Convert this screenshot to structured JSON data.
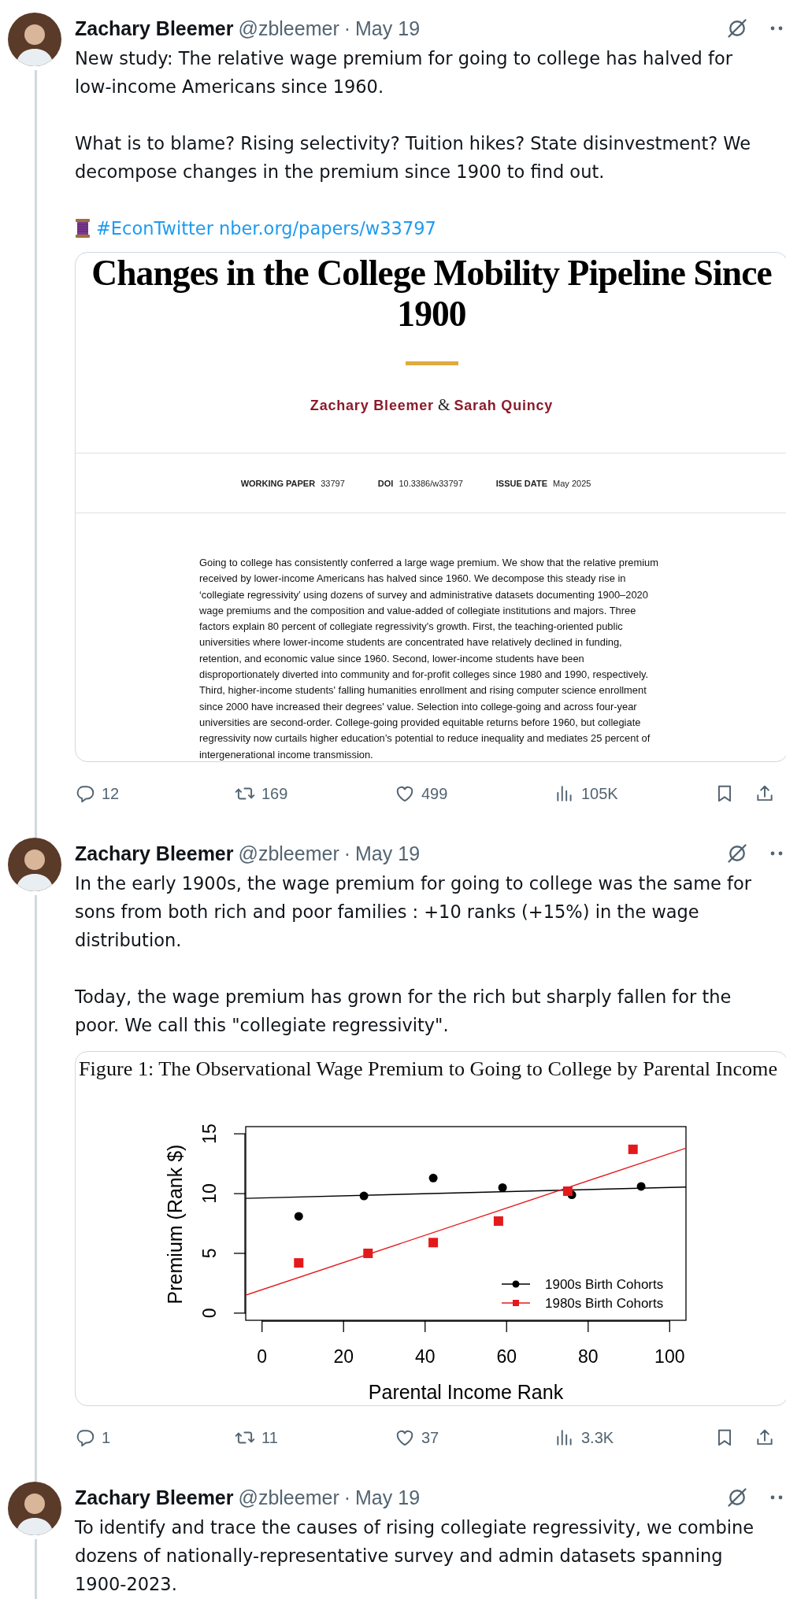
{
  "thread": [
    {
      "author": {
        "name": "Zachary Bleemer",
        "handle": "@zbleemer",
        "separator": "·",
        "date": "May 19"
      },
      "paragraphs": [
        {
          "kind": "text",
          "text": "New study: The relative wage premium for going to college has halved for low-income Americans since 1960."
        },
        {
          "kind": "text",
          "text": "What is to blame? Rising selectivity? Tuition hikes? State disinvestment? We decompose changes in the premium since 1900 to find out."
        },
        {
          "kind": "links",
          "links": [
            {
              "text": "#EconTwitter"
            },
            {
              "text": "nber.org/papers/w33797"
            }
          ]
        }
      ],
      "card": {
        "kind": "paper",
        "title": "Changes in the College Mobility Pipeline Since 1900",
        "authors": [
          {
            "name": "Zachary Bleemer"
          },
          {
            "name": "Sarah Quincy"
          }
        ],
        "conjunction": "&",
        "meta": [
          {
            "label": "WORKING PAPER",
            "value": "33797"
          },
          {
            "label": "DOI",
            "value": "10.3386/w33797"
          },
          {
            "label": "ISSUE DATE",
            "value": "May 2025"
          }
        ],
        "abstract": "Going to college has consistently conferred a large wage premium. We show that the relative premium received by lower-income Americans has halved since 1960. We decompose this steady rise in ‘collegiate regressivity’ using dozens of survey and administrative datasets documenting 1900–2020 wage premiums and the composition and value-added of collegiate institutions and majors. Three factors explain 80 percent of collegiate regressivity's growth. First, the teaching-oriented public universities where lower-income students are concentrated have relatively declined in funding, retention, and economic value since 1960. Second, lower-income students have been disproportionately diverted into community and for-profit colleges since 1980 and 1990, respectively. Third, higher-income students' falling humanities enrollment and rising computer science enrollment since 2000 have increased their degrees' value. Selection into college-going and across four-year universities are second-order. College-going provided equitable returns before 1960, but collegiate regressivity now curtails higher education’s potential to reduce inequality and mediates 25 percent of intergenerational income transmission."
      },
      "actions": [
        {
          "kind": "reply",
          "count": "12"
        },
        {
          "kind": "repost",
          "count": "169"
        },
        {
          "kind": "like",
          "count": "499"
        },
        {
          "kind": "views",
          "count": "105K"
        },
        {
          "kind": "bookmark"
        },
        {
          "kind": "share"
        }
      ]
    },
    {
      "author": {
        "name": "Zachary Bleemer",
        "handle": "@zbleemer",
        "separator": "·",
        "date": "May 19"
      },
      "paragraphs": [
        {
          "kind": "text",
          "text": "In the early 1900s, the wage premium for going to college was the same for sons from both rich and poor families : +10 ranks (+15%) in the wage distribution."
        },
        {
          "kind": "text",
          "text": "Today, the wage premium has grown for the rich but sharply fallen for the poor. We call this \"collegiate regressivity\"."
        }
      ],
      "card": {
        "kind": "figure",
        "chart_data": {
          "type": "scatter",
          "title": "Figure 1: The Observational Wage Premium to Going to College by Parental Income",
          "xlabel": "Parental Income Rank",
          "ylabel": "Premium (Rank $)",
          "xlim": [
            -4,
            104
          ],
          "ylim": [
            -0.6,
            15.6
          ],
          "xticks": [
            0,
            20,
            40,
            60,
            80,
            100
          ],
          "yticks": [
            0,
            5,
            10,
            15
          ],
          "legend": "lower right",
          "series": [
            {
              "name": "1900s Birth Cohorts",
              "color": "#000000",
              "marker": "circle",
              "x": [
                9,
                25,
                42,
                59,
                76,
                93
              ],
              "values": [
                8.1,
                9.8,
                11.3,
                10.5,
                9.9,
                10.6
              ]
            },
            {
              "name": "1980s Birth Cohorts",
              "color": "#e31a1c",
              "marker": "square",
              "x": [
                9,
                26,
                42,
                58,
                75,
                91
              ],
              "values": [
                4.2,
                5.0,
                5.9,
                7.7,
                10.2,
                13.7
              ]
            },
            {
              "type": "line",
              "color": "#000000",
              "x": [
                -4,
                104
              ],
              "values": [
                9.6,
                10.55
              ]
            },
            {
              "type": "line",
              "color": "#e31a1c",
              "x": [
                -4,
                104
              ],
              "values": [
                1.5,
                13.8
              ]
            }
          ]
        }
      },
      "actions": [
        {
          "kind": "reply",
          "count": "1"
        },
        {
          "kind": "repost",
          "count": "11"
        },
        {
          "kind": "like",
          "count": "37"
        },
        {
          "kind": "views",
          "count": "3.3K"
        },
        {
          "kind": "bookmark"
        },
        {
          "kind": "share"
        }
      ]
    },
    {
      "author": {
        "name": "Zachary Bleemer",
        "handle": "@zbleemer",
        "separator": "·",
        "date": "May 19"
      },
      "paragraphs": [
        {
          "kind": "text",
          "text": "To identify and trace the causes of rising collegiate regressivity, we combine dozens of nationally-representative survey and admin datasets spanning 1900-2023."
        }
      ]
    }
  ]
}
